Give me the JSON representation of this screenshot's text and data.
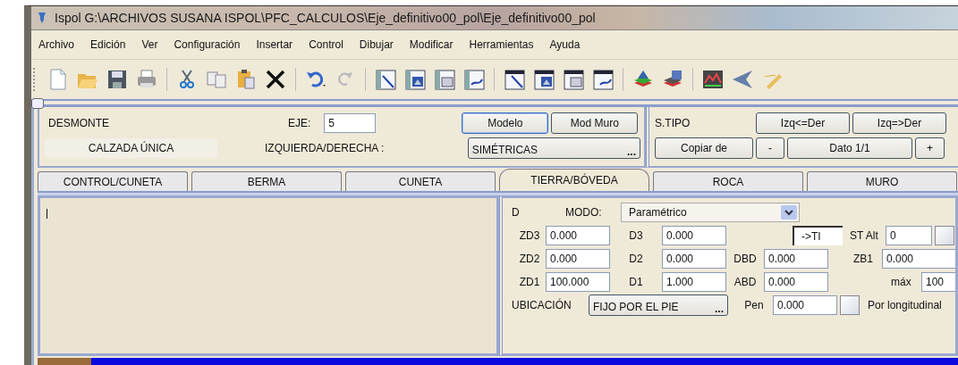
{
  "window": {
    "title": "Ispol  G:\\ARCHIVOS SUSANA ISPOL\\PFC_CALCULOS\\Eje_definitivo00_pol\\Eje_definitivo00_pol"
  },
  "menu": [
    "Archivo",
    "Edición",
    "Ver",
    "Configuración",
    "Insertar",
    "Control",
    "Dibujar",
    "Modificar",
    "Herramientas",
    "Ayuda"
  ],
  "section": {
    "type_label": "DESMONTE",
    "carriageway": "CALZADA ÚNICA",
    "axis_label": "EJE:",
    "axis_value": "5",
    "side_label": "IZQUIERDA/DERECHA :",
    "side_value": "SIMÉTRICAS",
    "side_more": "...",
    "buttons": [
      {
        "label": "Modelo",
        "focused": true
      },
      {
        "label": "Mod Muro",
        "focused": false
      }
    ]
  },
  "type_section": {
    "label": "S.TIPO",
    "copy": "Copiar de",
    "prev": "-",
    "record": "Dato 1/1",
    "next": "+",
    "buttons": [
      "Izq<=Der",
      "Izq=>Der"
    ]
  },
  "tabs": [
    {
      "label": "CONTROL/CUNETA",
      "selected": false
    },
    {
      "label": "BERMA",
      "selected": false
    },
    {
      "label": "CUNETA",
      "selected": false
    },
    {
      "label": "TIERRA/BÓVEDA",
      "selected": true
    },
    {
      "label": "ROCA",
      "selected": false
    },
    {
      "label": "MURO",
      "selected": false
    }
  ],
  "params": {
    "side": "D",
    "mode_label": "MODO:",
    "mode_value": "Paramétrico",
    "rows": [
      [
        {
          "label": "ZD3",
          "value": "0.000"
        },
        {
          "label": "D3",
          "value": "0.000"
        }
      ],
      [
        {
          "label": "ZD2",
          "value": "0.000"
        },
        {
          "label": "D2",
          "value": "0.000"
        },
        {
          "label": "DBD",
          "value": "0.000"
        }
      ],
      [
        {
          "label": "ZD1",
          "value": "100.000"
        },
        {
          "label": "D1",
          "value": "1.000"
        },
        {
          "label": "ABD",
          "value": "0.000"
        }
      ]
    ],
    "to_ti": "->TI",
    "st_alt_label": "ST Alt",
    "st_alt_value": "0",
    "st_alt_check": false,
    "zb1_label": "ZB1",
    "zb1_value": "0.000",
    "max_label": "máx",
    "max_value": "100",
    "location_label": "UBICACIÓN",
    "location_value": "FIJO POR EL PIE",
    "location_more": "...",
    "pen_label": "Pen",
    "pen_value": "0.000",
    "longitudinal_check": false,
    "longitudinal_label": "Por longitudinal"
  }
}
